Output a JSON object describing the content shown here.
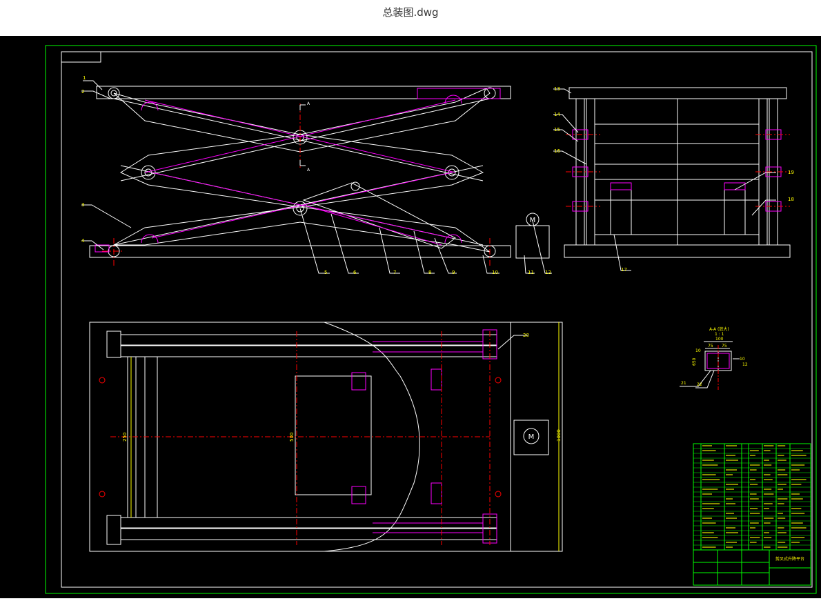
{
  "window": {
    "title": "总装图.dwg"
  },
  "drawing": {
    "colors": {
      "line": "#ffffff",
      "hidden": "#ff00ff",
      "center": "#ff0000",
      "dim": "#ffff00",
      "border": "#00ff00",
      "bg": "#000000"
    },
    "part_labels": [
      "1",
      "2",
      "3",
      "4",
      "5",
      "6",
      "7",
      "8",
      "9",
      "10",
      "11",
      "12",
      "13",
      "14",
      "15",
      "16",
      "17",
      "18",
      "19",
      "20",
      "21",
      "22"
    ],
    "section_mark": "A",
    "section_title": "A-A (放大)",
    "section_scale": "1 : 1",
    "dim_100": "100",
    "dim_75a": "75",
    "dim_75b": "75",
    "dim_10a": "10",
    "dim_10b": "10",
    "dim_12": "12",
    "dim_250": "250",
    "dim_650": "650",
    "dim_500": "500",
    "dim_1000": "1000",
    "motor_symbol": "M",
    "title_block_name": "剪叉式升降平台"
  }
}
